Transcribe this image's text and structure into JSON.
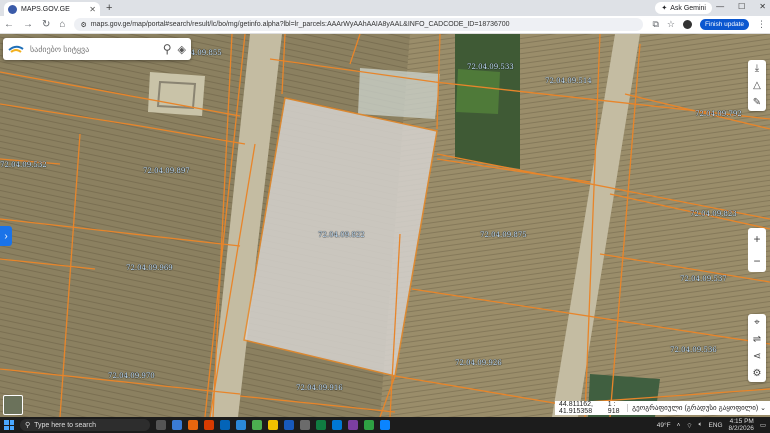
{
  "browser": {
    "tab_title": "MAPS.GOV.GE",
    "url": "maps.gov.ge/map/portal#search/result/lc/bo/mg/getinfo.alpha?lbl=lr_parcels:AAArWyAAhAAIA8yAAL&INFO_CADCODE_ID=18736700",
    "ask_gemini": "Ask Gemini",
    "finish_update": "Finish update"
  },
  "search": {
    "placeholder": "საძიებო სიტყვა"
  },
  "parcels": [
    "72.04.09.897",
    "72.04.09.822",
    "72.04.09.857",
    "72.04.09.875",
    "72.04.09.969",
    "72.04.09.970",
    "72.04.09.916",
    "72.04.09.926",
    "72.04.09.533",
    "72.04.09.514",
    "72.04.09.792",
    "72.04.09.823",
    "72.04.09.537",
    "72.04.09.536",
    "72.04.09.532",
    "72.04.09.855"
  ],
  "status": {
    "coords": "44.811162, 41.915358",
    "scale": "1 : 918",
    "projection": "გეოგრაფიული (გრადუსი გაყოფილი)"
  },
  "taskbar": {
    "search_placeholder": "Type here to search",
    "temp": "49°F",
    "lang": "ENG",
    "time": "4:15 PM",
    "date": "8/2/2026"
  }
}
